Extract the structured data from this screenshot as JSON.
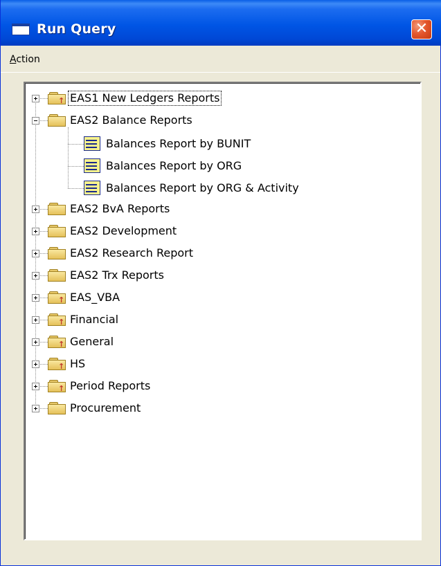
{
  "window": {
    "title": "Run Query",
    "close_glyph": "✕"
  },
  "menu": {
    "action_accel": "A",
    "action_rest": "ction"
  },
  "tree": {
    "nodes": [
      {
        "label": "EAS1 New Ledgers Reports",
        "icon": "folder-with-arrow-icon",
        "state": "collapsed",
        "selected": true
      },
      {
        "label": "EAS2 Balance Reports",
        "icon": "folder-icon",
        "state": "expanded",
        "children": [
          {
            "label": "Balances Report by BUNIT",
            "icon": "report-icon"
          },
          {
            "label": "Balances Report by ORG",
            "icon": "report-icon"
          },
          {
            "label": "Balances Report by ORG & Activity",
            "icon": "report-icon"
          }
        ]
      },
      {
        "label": "EAS2 BvA Reports",
        "icon": "folder-icon",
        "state": "collapsed"
      },
      {
        "label": "EAS2 Development",
        "icon": "folder-icon",
        "state": "collapsed"
      },
      {
        "label": "EAS2 Research Report",
        "icon": "folder-icon",
        "state": "collapsed"
      },
      {
        "label": "EAS2 Trx Reports",
        "icon": "folder-icon",
        "state": "collapsed"
      },
      {
        "label": "EAS_VBA",
        "icon": "folder-with-arrow-icon",
        "state": "collapsed"
      },
      {
        "label": "Financial",
        "icon": "folder-with-arrow-icon",
        "state": "collapsed"
      },
      {
        "label": "General",
        "icon": "folder-with-arrow-icon",
        "state": "collapsed"
      },
      {
        "label": "HS",
        "icon": "folder-with-arrow-icon",
        "state": "collapsed"
      },
      {
        "label": "Period Reports",
        "icon": "folder-with-arrow-icon",
        "state": "collapsed"
      },
      {
        "label": "Procurement",
        "icon": "folder-icon",
        "state": "collapsed"
      }
    ]
  }
}
